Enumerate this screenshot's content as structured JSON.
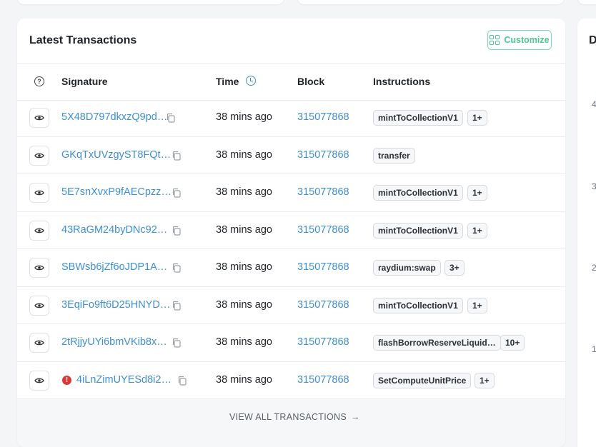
{
  "card": {
    "title": "Latest Transactions",
    "customize_label": "Customize"
  },
  "table": {
    "help_icon": "?",
    "columns": {
      "signature": "Signature",
      "time": "Time",
      "block": "Block",
      "instructions": "Instructions"
    },
    "rows": [
      {
        "signature": "5X48D797dkxzQ9pd…",
        "time": "38 mins ago",
        "block": "315077868",
        "tag1": "mintToCollectionV1",
        "tag2": "1+",
        "error": false
      },
      {
        "signature": "GKqTxUVzgySТ8FQt…",
        "time": "38 mins ago",
        "block": "315077868",
        "tag1": "transfer",
        "tag2": "",
        "error": false
      },
      {
        "signature": "5E7snXvxP9fAECpzz…",
        "time": "38 mins ago",
        "block": "315077868",
        "tag1": "mintToCollectionV1",
        "tag2": "1+",
        "error": false
      },
      {
        "signature": "43RaGM24byDNc92…",
        "time": "38 mins ago",
        "block": "315077868",
        "tag1": "mintToCollectionV1",
        "tag2": "1+",
        "error": false
      },
      {
        "signature": "SBWsb6jZf6oJDP1A…",
        "time": "38 mins ago",
        "block": "315077868",
        "tag1": "raydium:swap",
        "tag2": "3+",
        "error": false
      },
      {
        "signature": "3EqiFo9ft6D25HNYD…",
        "time": "38 mins ago",
        "block": "315077868",
        "tag1": "mintToCollectionV1",
        "tag2": "1+",
        "error": false
      },
      {
        "signature": "2tRjjyUYi6bmVKib8x…",
        "time": "38 mins ago",
        "block": "315077868",
        "tag1": "flashBorrowReserveLiquid…",
        "tag2": "10+",
        "error": false
      },
      {
        "signature": "4iLnZimUYESd8i2…",
        "time": "38 mins ago",
        "block": "315077868",
        "tag1": "SetComputeUnitPrice",
        "tag2": "1+",
        "error": true
      }
    ],
    "error_icon": "!"
  },
  "footer": {
    "view_all_label": "VIEW ALL TRANSACTIONS",
    "arrow": "→"
  },
  "side_card": {
    "title_fragment": "D",
    "ticks": [
      "4",
      "3",
      "2",
      "1"
    ]
  },
  "colors": {
    "link": "#3d8fd1",
    "accent_green": "#4cc793",
    "error": "#d63a3a"
  }
}
